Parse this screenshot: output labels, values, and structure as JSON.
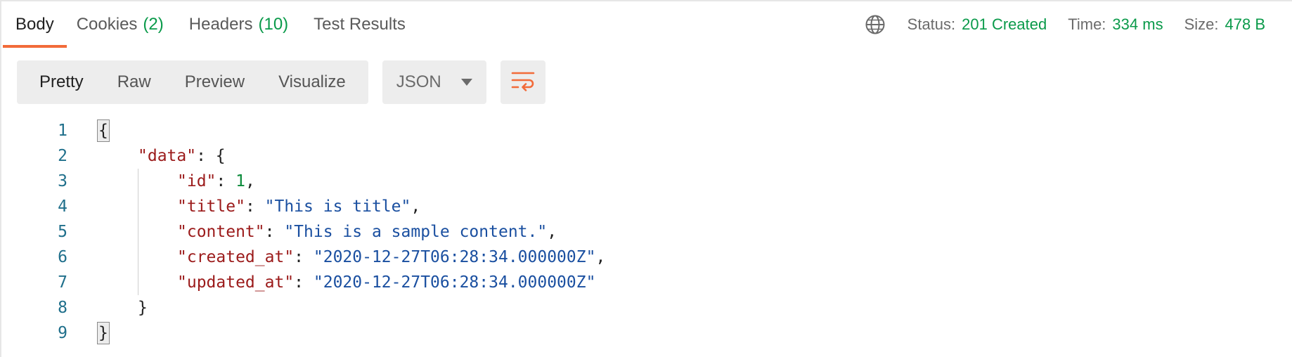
{
  "tabs": {
    "body": "Body",
    "cookies": "Cookies",
    "cookies_count": "(2)",
    "headers": "Headers",
    "headers_count": "(10)",
    "test_results": "Test Results"
  },
  "meta": {
    "globe_icon": "globe-icon",
    "status_label": "Status:",
    "status_value": "201 Created",
    "time_label": "Time:",
    "time_value": "334 ms",
    "size_label": "Size:",
    "size_value": "478 B"
  },
  "toolbar": {
    "pretty": "Pretty",
    "raw": "Raw",
    "preview": "Preview",
    "visualize": "Visualize",
    "format": "JSON",
    "wrap_icon": "wrap-lines-icon"
  },
  "colors": {
    "accent": "#f26b3a",
    "success": "#0a9a4a",
    "json_key": "#9b1a1a",
    "json_string": "#1a4fa0",
    "json_number": "#0a8a3a"
  },
  "editor": {
    "line_numbers": [
      "1",
      "2",
      "3",
      "4",
      "5",
      "6",
      "7",
      "8",
      "9"
    ],
    "open_brace": "{",
    "close_brace": "}",
    "data_key": "\"data\"",
    "data_sep": ": {",
    "data_close": "}",
    "fields": [
      {
        "key": "\"id\"",
        "sep": ": ",
        "value": "1",
        "trail": ","
      },
      {
        "key": "\"title\"",
        "sep": ": ",
        "value": "\"This is title\"",
        "trail": ","
      },
      {
        "key": "\"content\"",
        "sep": ": ",
        "value": "\"This is a sample content.\"",
        "trail": ","
      },
      {
        "key": "\"created_at\"",
        "sep": ": ",
        "value": "\"2020-12-27T06:28:34.000000Z\"",
        "trail": ","
      },
      {
        "key": "\"updated_at\"",
        "sep": ": ",
        "value": "\"2020-12-27T06:28:34.000000Z\"",
        "trail": ""
      }
    ]
  }
}
